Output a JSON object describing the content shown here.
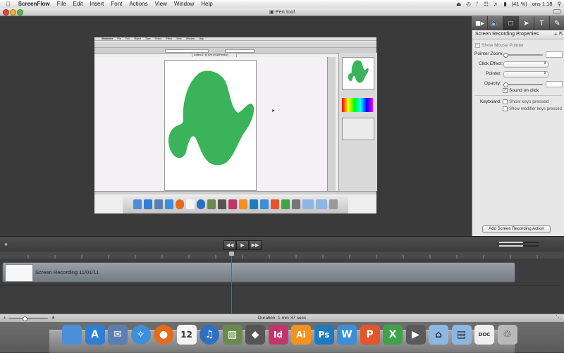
{
  "menubar": {
    "app_name": "ScreenFlow",
    "items": [
      "File",
      "Edit",
      "Insert",
      "Font",
      "Actions",
      "View",
      "Window",
      "Help"
    ],
    "battery": "(41 %)",
    "clock": "ons 1.18"
  },
  "window": {
    "title": "Pen tool"
  },
  "recording": {
    "inner_app": "Illustrator",
    "inner_menu": [
      "File",
      "Edit",
      "Object",
      "Type",
      "Select",
      "Effect",
      "View",
      "Window",
      "Help"
    ],
    "inner_doc_tab": "Untitled-1* @ 60% (RGB/Preview)",
    "shape_color": "#3bb35a"
  },
  "inspector": {
    "title": "Screen Recording Properties",
    "add_symbol": "+",
    "collapse_symbol": "⇱",
    "show_pointer_label": "Show Mouse Pointer",
    "pointer_zoom_label": "Pointer Zoom:",
    "click_effect_label": "Click Effect:",
    "pointer_label": "Pointer:",
    "opacity_label": "Opacity:",
    "sound_on_click_label": "Sound on click",
    "keyboard_label": "Keyboard:",
    "show_keys_label": "Show keys pressed",
    "show_modifier_label": "Show modifier keys pressed",
    "add_action_button": "Add Screen Recording Action"
  },
  "timeline": {
    "clip_label": "Screen Recording 11/01/11",
    "duration": "Duration: 1 min 37 secs"
  },
  "dock": {
    "apps": [
      {
        "name": "finder",
        "label": "",
        "color": "#4a8fd8"
      },
      {
        "name": "app-store",
        "label": "A",
        "color": "#2f7fd4"
      },
      {
        "name": "mail",
        "label": "✉",
        "color": "#5a7fb0"
      },
      {
        "name": "safari",
        "label": "✧",
        "color": "#3d8fd9"
      },
      {
        "name": "firefox",
        "label": "●",
        "color": "#e56a1c"
      },
      {
        "name": "calendar",
        "label": "12",
        "color": "#f4f4f4"
      },
      {
        "name": "itunes",
        "label": "♫",
        "color": "#2d6fc0"
      },
      {
        "name": "iphoto",
        "label": "▧",
        "color": "#6b8a4e"
      },
      {
        "name": "automator",
        "label": "◆",
        "color": "#555"
      },
      {
        "name": "indesign",
        "label": "Id",
        "color": "#c2356b"
      },
      {
        "name": "illustrator",
        "label": "Ai",
        "color": "#f5921f"
      },
      {
        "name": "photoshop",
        "label": "Ps",
        "color": "#1f7bc1"
      },
      {
        "name": "word",
        "label": "W",
        "color": "#3a8fd8"
      },
      {
        "name": "powerpoint",
        "label": "P",
        "color": "#e2562a"
      },
      {
        "name": "excel",
        "label": "X",
        "color": "#3fa34a"
      },
      {
        "name": "screenflow",
        "label": "▶",
        "color": "#5a5a5a"
      },
      {
        "name": "applications-folder",
        "label": "⌂",
        "color": "#8db7e3"
      },
      {
        "name": "documents-folder",
        "label": "▤",
        "color": "#8db7e3"
      },
      {
        "name": "document",
        "label": "DOC",
        "color": "#efefef"
      },
      {
        "name": "trash",
        "label": "♲",
        "color": "#b9b9b9"
      }
    ]
  }
}
